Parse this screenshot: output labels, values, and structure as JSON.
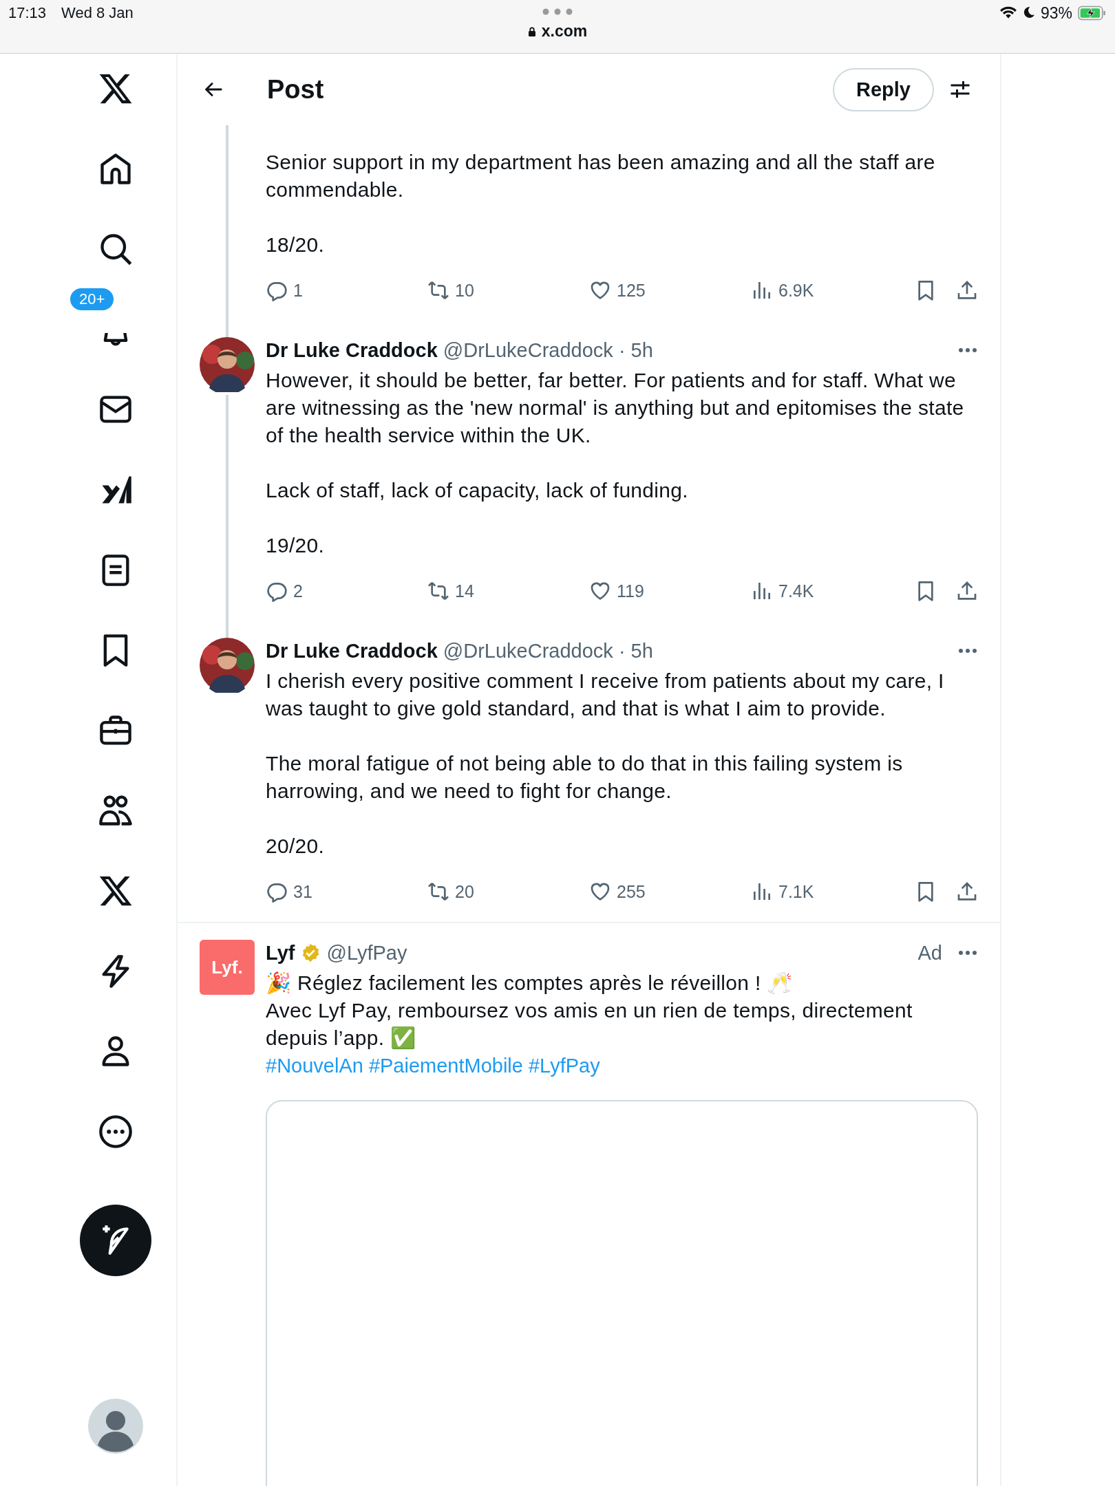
{
  "status_bar": {
    "time": "17:13",
    "date": "Wed 8 Jan",
    "url": "x.com",
    "battery": "93%",
    "charging": true
  },
  "sidebar": {
    "items": [
      {
        "kind": "logo"
      },
      {
        "kind": "home"
      },
      {
        "kind": "search"
      },
      {
        "kind": "notifications",
        "badge": "20+"
      },
      {
        "kind": "messages"
      },
      {
        "kind": "grok"
      },
      {
        "kind": "lists"
      },
      {
        "kind": "bookmarks"
      },
      {
        "kind": "jobs"
      },
      {
        "kind": "communities"
      },
      {
        "kind": "premium"
      },
      {
        "kind": "verified_orgs"
      },
      {
        "kind": "profile"
      },
      {
        "kind": "more"
      }
    ]
  },
  "header": {
    "title": "Post",
    "reply_button": "Reply"
  },
  "posts": [
    {
      "kind": "continuation",
      "connected_below": true,
      "paragraphs": [
        "Senior support in my department has been amazing and all the staff are commendable.",
        "18/20."
      ],
      "actions": {
        "replies": "1",
        "reposts": "10",
        "likes": "125",
        "views": "6.9K"
      }
    },
    {
      "kind": "full",
      "connected_below": true,
      "author": "Dr Luke Craddock",
      "meta": "@DrLukeCraddock · 5h",
      "paragraphs": [
        "However, it should be better, far better. For patients and for staff. What we are witnessing as the 'new normal' is anything but and epitomises the state of the health service within the UK.",
        "Lack of staff, lack of capacity, lack of funding.",
        "19/20."
      ],
      "actions": {
        "replies": "2",
        "reposts": "14",
        "likes": "119",
        "views": "7.4K"
      }
    },
    {
      "kind": "full",
      "connected_below": false,
      "author": "Dr Luke Craddock",
      "meta": "@DrLukeCraddock · 5h",
      "paragraphs": [
        "I cherish every positive comment I receive from patients about my care, I was taught to give gold standard, and that is what I aim to provide.",
        "The moral fatigue of not being able to do that in this failing system is harrowing, and we need to fight for change.",
        "20/20."
      ],
      "actions": {
        "replies": "31",
        "reposts": "20",
        "likes": "255",
        "views": "7.1K"
      }
    }
  ],
  "ad": {
    "logo": "Lyf.",
    "name": "Lyf",
    "verified": true,
    "handle": "@LyfPay",
    "label": "Ad",
    "lines": [
      "🎉 Réglez facilement les comptes après le réveillon ! 🥂",
      "Avec Lyf Pay, remboursez vos amis en un rien de temps, directement depuis l’app. ✅"
    ],
    "hashtags": [
      "#NouvelAn",
      "#PaiementMobile",
      "#LyfPay"
    ]
  }
}
